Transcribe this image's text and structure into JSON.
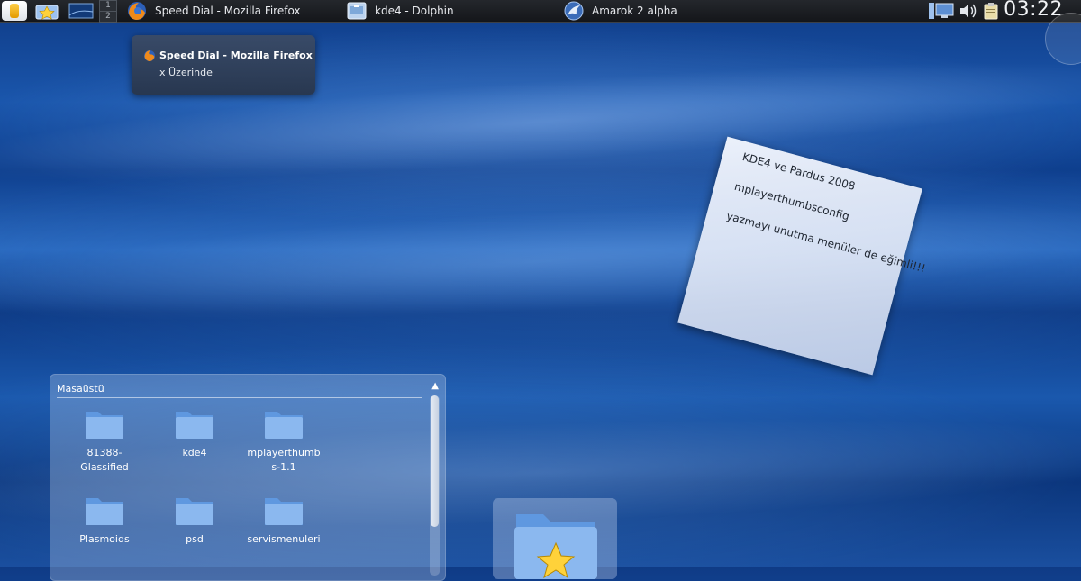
{
  "taskbar": {
    "pager": [
      "1",
      "2"
    ],
    "tasks": [
      {
        "label": "Speed Dial - Mozilla Firefox",
        "icon": "firefox-icon"
      },
      {
        "label": "kde4 - Dolphin",
        "icon": "dolphin-icon"
      },
      {
        "label": "Amarok 2 alpha",
        "icon": "amarok-icon"
      }
    ],
    "clock": "03:22"
  },
  "tooltip": {
    "title": "Speed Dial - Mozilla Firefox",
    "subtitle": "x Üzerinde"
  },
  "note": {
    "lines": [
      "KDE4 ve Pardus 2008",
      "mplayerthumbsconfig",
      "yazmayı unutma menüler de eğimli!!!"
    ]
  },
  "folderview": {
    "title": "Masaüstü",
    "items": [
      {
        "label": "81388-\nGlassified"
      },
      {
        "label": "kde4"
      },
      {
        "label": "mplayerthumb\ns-1.1"
      },
      {
        "label": "Plasmoids"
      },
      {
        "label": "psd"
      },
      {
        "label": "servismenuleri"
      }
    ]
  },
  "colors": {
    "accent": "#1a56ac",
    "folder": "#6aa2e6"
  }
}
